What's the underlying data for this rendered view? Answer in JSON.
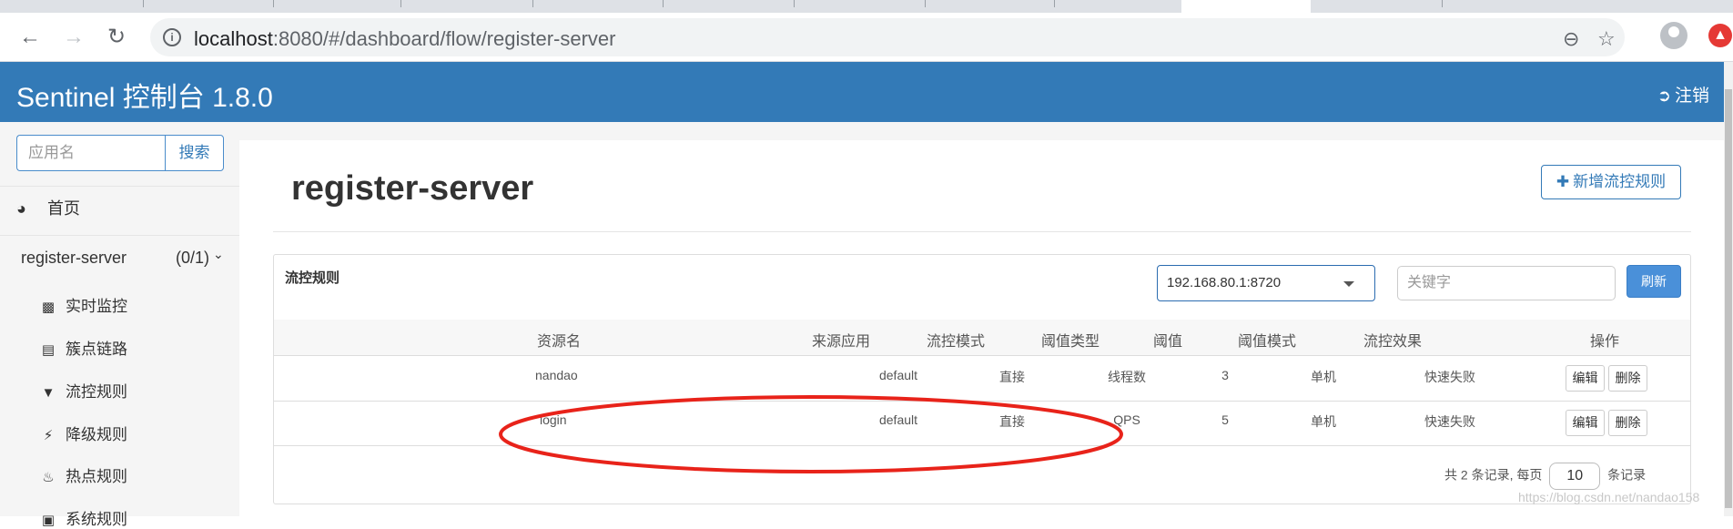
{
  "browser": {
    "url_host": "localhost",
    "url_path": ":8080/#/dashboard/flow/register-server"
  },
  "header": {
    "brand": "Sentinel 控制台 1.8.0",
    "logout_label": "注销"
  },
  "sidebar": {
    "search_placeholder": "应用名",
    "search_button": "搜索",
    "home_label": "首页",
    "app_name": "register-server",
    "app_count": "(0/1)",
    "menu": [
      {
        "label": "实时监控",
        "icon": "bar-chart-icon"
      },
      {
        "label": "簇点链路",
        "icon": "list-icon"
      },
      {
        "label": "流控规则",
        "icon": "filter-icon"
      },
      {
        "label": "降级规则",
        "icon": "flash-icon"
      },
      {
        "label": "热点规则",
        "icon": "fire-icon"
      },
      {
        "label": "系统规则",
        "icon": "lock-icon"
      }
    ]
  },
  "main": {
    "title": "register-server",
    "add_button": "新增流控规则",
    "panel_title": "流控规则",
    "machine_selected": "192.168.80.1:8720",
    "keyword_placeholder": "关键字",
    "refresh_button": "刷新",
    "columns": [
      "资源名",
      "来源应用",
      "流控模式",
      "阈值类型",
      "阈值",
      "阈值模式",
      "流控效果",
      "操作"
    ],
    "rows": [
      {
        "resource": "nandao",
        "origin": "default",
        "mode": "直接",
        "grade": "线程数",
        "count": "3",
        "cluster": "单机",
        "effect": "快速失败",
        "edit": "编辑",
        "delete": "删除"
      },
      {
        "resource": "login",
        "origin": "default",
        "mode": "直接",
        "grade": "QPS",
        "count": "5",
        "cluster": "单机",
        "effect": "快速失败",
        "edit": "编辑",
        "delete": "删除"
      }
    ],
    "pager_prefix": "共 2 条记录, 每页",
    "pager_size": "10",
    "pager_suffix": "条记录"
  },
  "watermark": "https://blog.csdn.net/nandao158",
  "colors": {
    "header_bg": "#337ab7",
    "annotation": "#e8231a"
  }
}
